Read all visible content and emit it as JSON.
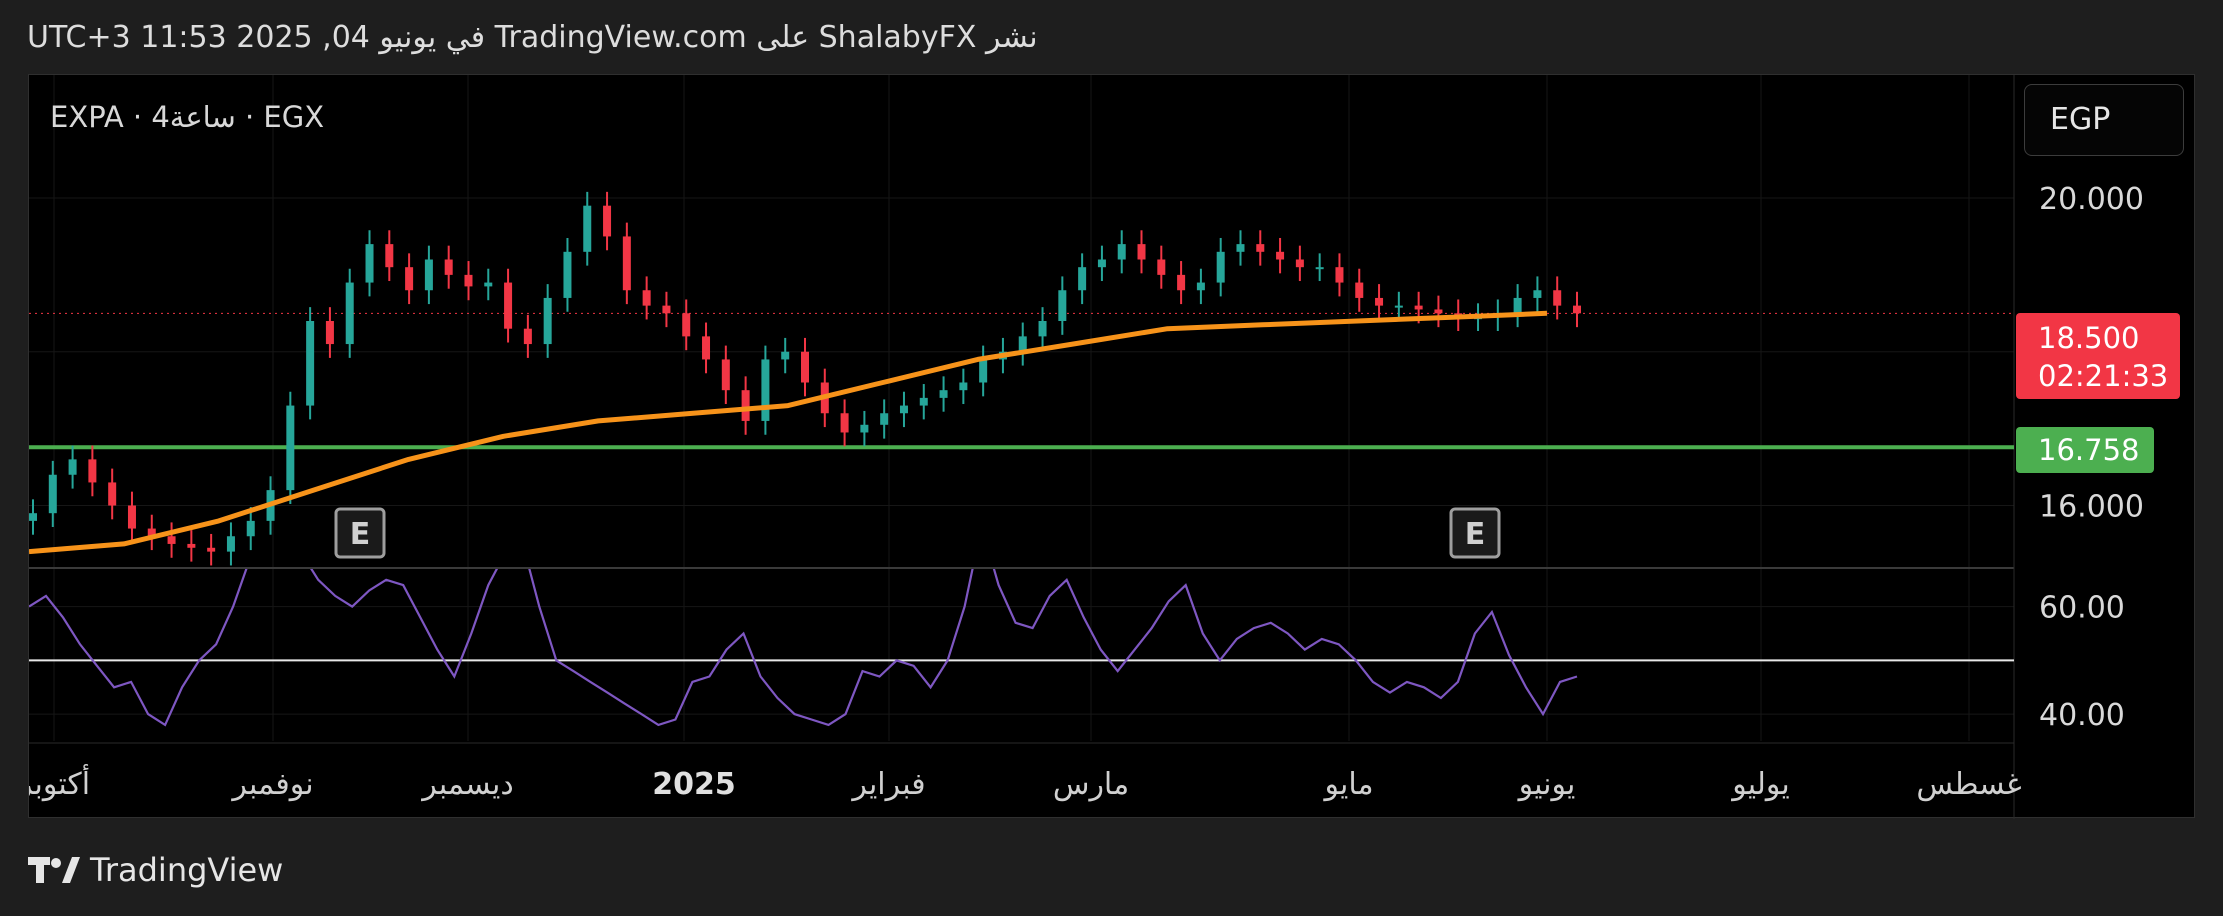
{
  "header": {
    "caption": "نشر ShalabyFX على TradingView.com في يونيو 04, 2025 11:53 UTC+3"
  },
  "symbol": {
    "label": "EXPA · 4ساعة · EGX",
    "currency": "EGP"
  },
  "price_tag": {
    "price": "18.500",
    "countdown": "02:21:33"
  },
  "level_tag": {
    "value": "16.758"
  },
  "footer": {
    "brand": "TradingView"
  },
  "colors": {
    "up": "#26a69a",
    "down": "#f23645",
    "ma": "#f7931a",
    "level": "#4caf50",
    "rsi": "#7e57c2",
    "background": "#000000"
  },
  "icons": {
    "earnings_marker": "E",
    "logo": "tradingview-logo-icon"
  },
  "chart_data": [
    {
      "type": "candlestick",
      "series": [
        {
          "name": "",
          "kind": "candles",
          "y": [
            15.9,
            16.4,
            16.6,
            16.3,
            16.0,
            15.7,
            15.6,
            15.5,
            15.45,
            15.4,
            15.6,
            15.8,
            16.2,
            17.3,
            18.4,
            18.1,
            18.9,
            19.4,
            19.1,
            18.8,
            19.2,
            19.0,
            18.85,
            18.9,
            18.3,
            18.1,
            18.7,
            19.3,
            19.9,
            19.5,
            18.8,
            18.6,
            18.5,
            18.2,
            17.9,
            17.5,
            17.1,
            17.9,
            18.0,
            17.6,
            17.2,
            16.95,
            17.05,
            17.2,
            17.3,
            17.4,
            17.5,
            17.6,
            17.9,
            18.0,
            18.2,
            18.4,
            18.8,
            19.1,
            19.2,
            19.4,
            19.2,
            19.0,
            18.8,
            18.9,
            19.3,
            19.4,
            19.3,
            19.2,
            19.1,
            19.1,
            18.9,
            18.7,
            18.6,
            18.6,
            18.55,
            18.5,
            18.45,
            18.45,
            18.5,
            18.7,
            18.8,
            18.6,
            18.5
          ]
        },
        {
          "name": "",
          "kind": "moving-average",
          "y": [
            15.4,
            15.5,
            15.8,
            16.2,
            16.6,
            16.9,
            17.1,
            17.2,
            17.3,
            17.6,
            17.9,
            18.1,
            18.3,
            18.35,
            18.4,
            18.45,
            18.5
          ]
        },
        {
          "name": "",
          "kind": "horizontal-level",
          "y": [
            16.758
          ]
        }
      ],
      "price_axis_ticks": [
        "20.000",
        "16.000"
      ],
      "ylim": [
        15.2,
        21.6
      ],
      "last_price": 18.5,
      "earnings_markers": [
        "E",
        "E"
      ],
      "grid": true
    },
    {
      "type": "line",
      "series": [
        {
          "name": "",
          "y": [
            60,
            62,
            58,
            53,
            49,
            45,
            46,
            40,
            38,
            45,
            50,
            53,
            60,
            69,
            73,
            75,
            70,
            65,
            62,
            60,
            63,
            65,
            64,
            58,
            52,
            47,
            55,
            64,
            70,
            72,
            60,
            50,
            48,
            46,
            44,
            42,
            40,
            38,
            39,
            46,
            47,
            52,
            55,
            47,
            43,
            40,
            39,
            38,
            40,
            48,
            47,
            50,
            49,
            45,
            50,
            60,
            75,
            64,
            57,
            56,
            62,
            65,
            58,
            52,
            48,
            52,
            56,
            61,
            64,
            55,
            50,
            54,
            56,
            57,
            55,
            52,
            54,
            53,
            50,
            46,
            44,
            46,
            45,
            43,
            46,
            55,
            59,
            51,
            45,
            40,
            46,
            47
          ]
        },
        {
          "name": "",
          "kind": "horizontal-level",
          "y": [
            50
          ]
        }
      ],
      "y_axis_ticks": [
        "60.00",
        "40.00"
      ],
      "ylim": [
        35,
        67
      ]
    }
  ],
  "time_axis_ticks": [
    "أكتوبر",
    "نوفمبر",
    "ديسمبر",
    "2025",
    "فبراير",
    "مارس",
    "مايو",
    "يونيو",
    "يوليو",
    "غسطس"
  ]
}
